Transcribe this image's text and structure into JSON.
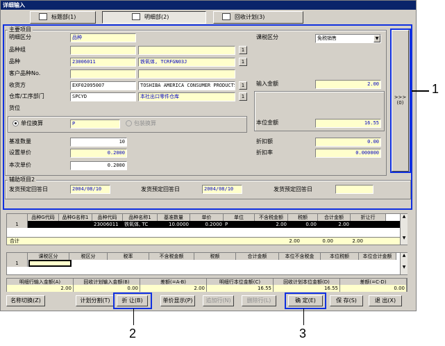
{
  "title": "详细输入",
  "tabs": [
    {
      "label": "标题部(1)"
    },
    {
      "label": "明细部(2)"
    },
    {
      "label": "回收计划(3)"
    }
  ],
  "main": {
    "group_title": "主要项目",
    "labels": {
      "detail_type": "明细区分",
      "item_group": "品种组",
      "item": "品种",
      "customer_item": "客户品种No.",
      "receiver": "收货方",
      "warehouse": "仓库/工序部门",
      "location": "货位",
      "tax_type": "课税区分",
      "input_amount": "输入金额",
      "local_amount": "本位金额",
      "base_qty": "基准数量",
      "set_price": "设置单价",
      "this_price": "本次单价",
      "discount_amt": "折扣额",
      "discount_rate": "折扣率",
      "unit_conv": "单位换算",
      "pack_conv": "包装换算"
    },
    "values": {
      "detail_type": "品种",
      "item_code": "23006011",
      "item_name": "铁氧体, TCRFGN03J",
      "receiver_code": "EXF02095007",
      "receiver_name": "TOSHIBA AMERICA CONSUMER PRODUCTS",
      "warehouse_code": "SPCYD",
      "warehouse_name": "本社出口零件仓库",
      "tax_type": "免税销售",
      "input_amount": "2.00",
      "local_amount": "16.55",
      "unit": "P",
      "base_qty": "10",
      "set_price": "0.2000",
      "this_price": "0.2000",
      "discount_amt": "0.00",
      "discount_rate": "0.000000"
    },
    "search_btn": "1",
    "side_btn": ">>>",
    "side_btn_key": "(0)"
  },
  "aux": {
    "group_title": "辅助项目2",
    "date_label": "发货预定回答日",
    "date1": "2004/08/10",
    "date2": "2004/08/10",
    "date3": ""
  },
  "grid1": {
    "headers": [
      "",
      "品种G代码",
      "品种G名称1",
      "品种代码",
      "品种名称1",
      "基准数量",
      "单价",
      "单位",
      "不含税金额",
      "税额",
      "合计金额",
      "折让行"
    ],
    "row_no": "1",
    "row": [
      "",
      "",
      "",
      "23006011",
      "铁氧体, TC",
      "10.0000",
      "0.2000",
      "P",
      "2.00",
      "0.00",
      "2.00",
      ""
    ],
    "total_label": "合计",
    "totals": [
      "2.00",
      "0.00",
      "2.00"
    ]
  },
  "grid2": {
    "headers": [
      "",
      "课税区分",
      "税区分",
      "税率",
      "不含税金额",
      "税额",
      "合计金额",
      "本位不含税金",
      "本位税额",
      "本位合计金额"
    ],
    "row_no": "1"
  },
  "summary": {
    "headers": [
      "明细行输入金额(A)",
      "回收计划输入金额(B)",
      "差额(=A-B)",
      "明细行本位金额(C)",
      "回收计划本位金额(D)",
      "差额(=C-D)"
    ],
    "values": [
      "2.00",
      "0.00",
      "2.00",
      "16.55",
      "16.55",
      "0.00"
    ]
  },
  "buttons": {
    "name_switch": "名称切换(Z)",
    "plan_split": "计划分割(T)",
    "discount": "折 让(B)",
    "price_display": "单价显示(P)",
    "add_row": "追加行(N)",
    "delete_row": "删除行(L)",
    "confirm": "确 定(E)",
    "save": "保 存(S)",
    "exit": "退 出(X)"
  },
  "callouts": {
    "c1": "1",
    "c2": "2",
    "c3": "3"
  },
  "colors": {
    "title_bar": "#0a246a",
    "highlight_box": "#1030e0",
    "field_yellow": "#ffffcc",
    "grid_selected": "#000000"
  }
}
